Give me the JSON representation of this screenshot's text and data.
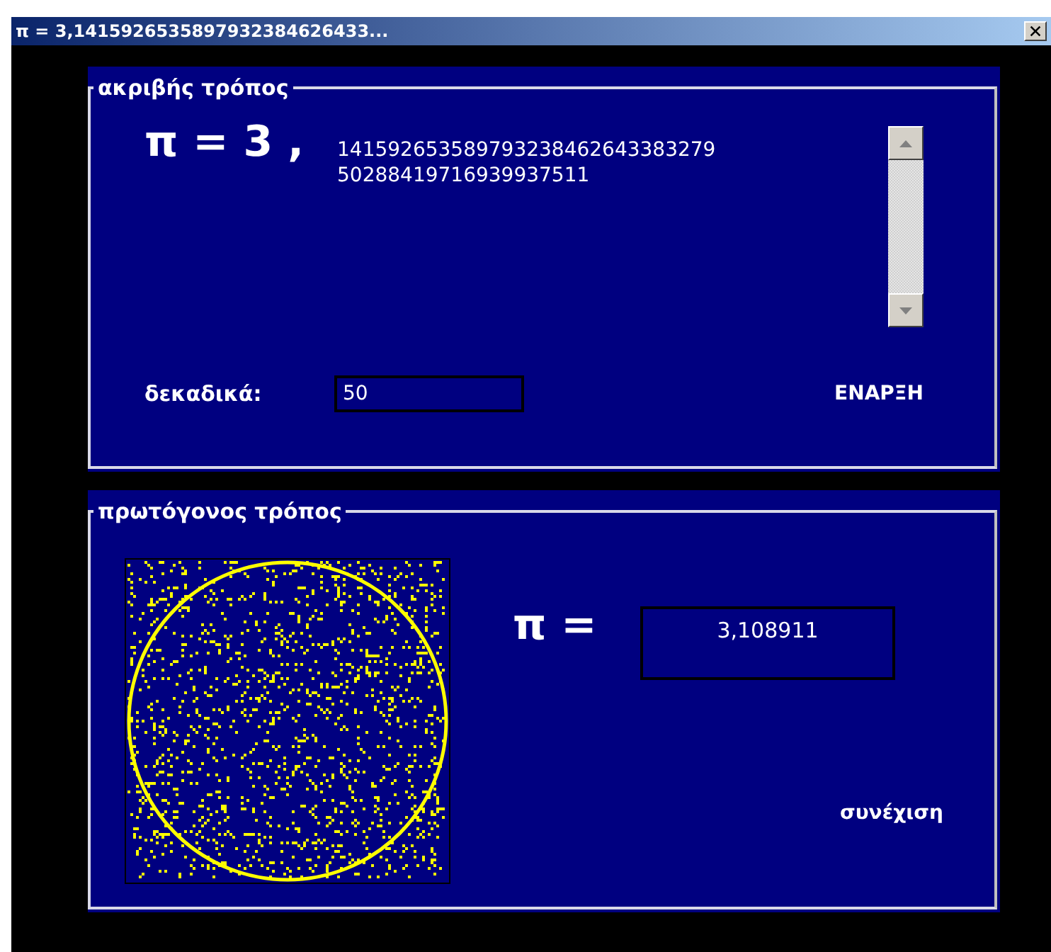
{
  "window": {
    "title": "π = 3,1415926535897932384626433..."
  },
  "exact_method": {
    "legend": "ακριβής τρόπος",
    "pi_label": "π = 3 ,",
    "digits": "141592653589793238462643383279\n50288419716939937511",
    "decimals_label": "δεκαδικά:",
    "decimals_value": "50",
    "start_button": "ΕΝΑΡΞΗ"
  },
  "primitive_method": {
    "legend": "πρωτόγονος τρόπος",
    "pi_label": "π =",
    "estimate": "3,108911",
    "continue_button": "συνέχιση"
  }
}
